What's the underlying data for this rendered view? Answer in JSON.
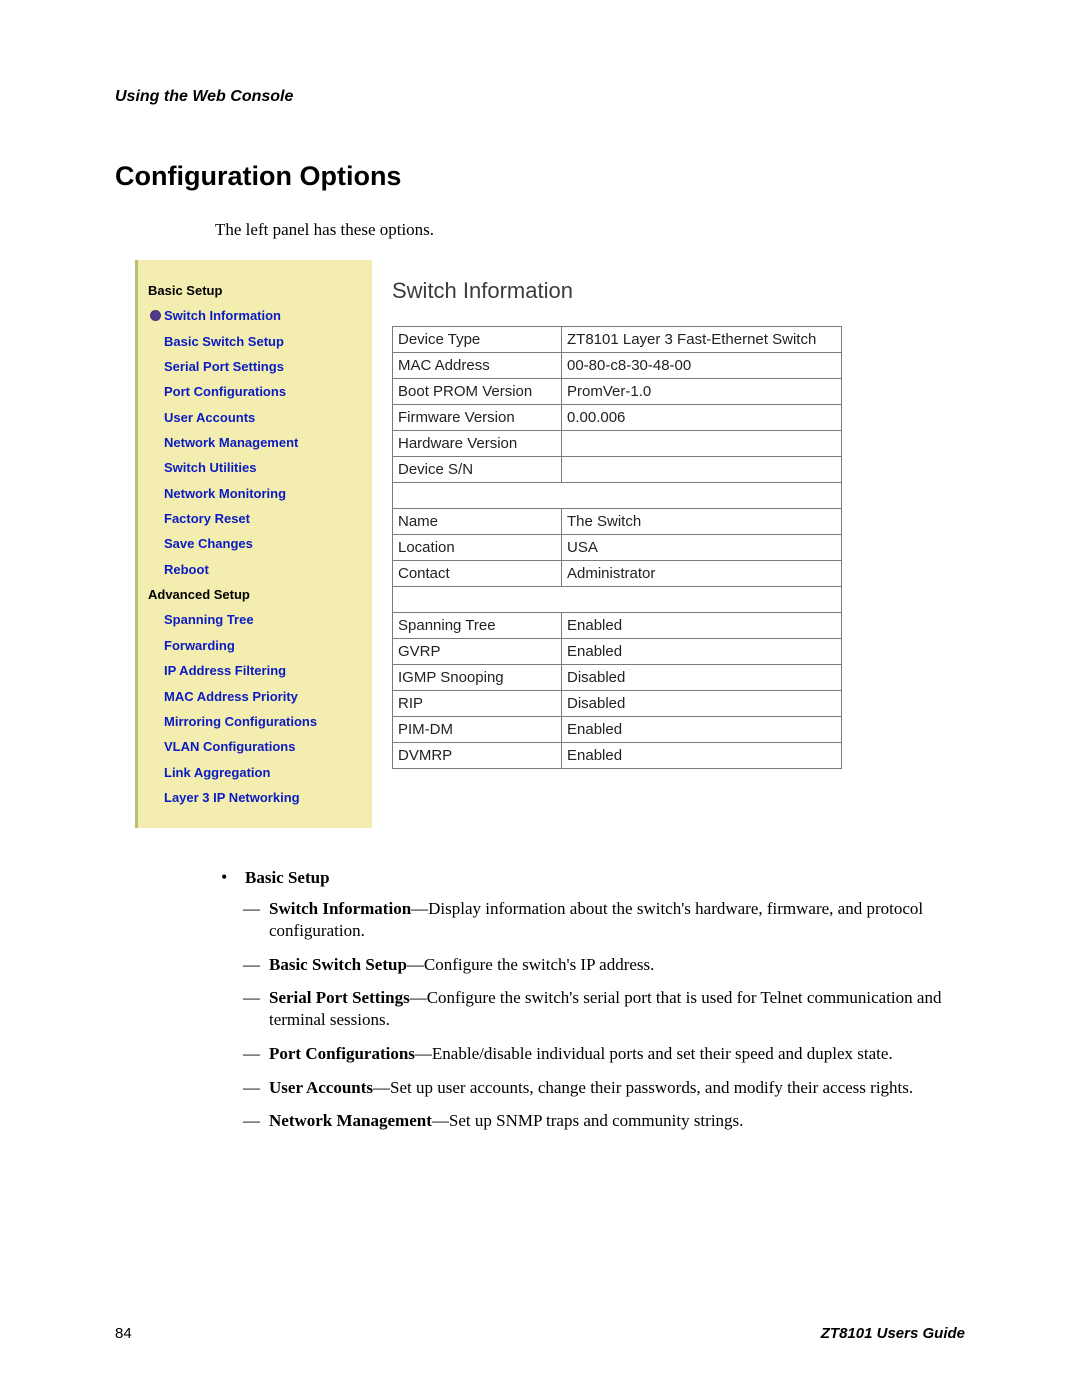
{
  "header": {
    "running": "Using the Web Console"
  },
  "section": {
    "title": "Configuration Options",
    "intro": "The left panel has these options."
  },
  "sidebar": {
    "groups": [
      {
        "label": "Basic Setup",
        "items": [
          "Switch Information",
          "Basic Switch Setup",
          "Serial Port Settings",
          "Port Configurations",
          "User Accounts",
          "Network Management",
          "Switch Utilities",
          "Network Monitoring",
          "Factory Reset",
          "Save Changes",
          "Reboot"
        ],
        "active_index": 0
      },
      {
        "label": "Advanced Setup",
        "items": [
          "Spanning Tree",
          "Forwarding",
          "IP Address Filtering",
          "MAC Address Priority",
          "Mirroring Configurations",
          "VLAN Configurations",
          "Link Aggregation",
          "Layer 3 IP Networking"
        ]
      }
    ]
  },
  "mainpane": {
    "title": "Switch Information",
    "rows": [
      {
        "k": "Device Type",
        "v": "ZT8101 Layer 3 Fast-Ethernet Switch"
      },
      {
        "k": "MAC Address",
        "v": "00-80-c8-30-48-00"
      },
      {
        "k": "Boot PROM Version",
        "v": "PromVer-1.0"
      },
      {
        "k": "Firmware Version",
        "v": "0.00.006"
      },
      {
        "k": "Hardware Version",
        "v": ""
      },
      {
        "k": "Device S/N",
        "v": ""
      },
      {
        "spacer": true
      },
      {
        "k": "Name",
        "v": "The Switch"
      },
      {
        "k": "Location",
        "v": "USA"
      },
      {
        "k": "Contact",
        "v": "Administrator"
      },
      {
        "spacer": true
      },
      {
        "k": "Spanning Tree",
        "v": "Enabled"
      },
      {
        "k": "GVRP",
        "v": "Enabled"
      },
      {
        "k": "IGMP Snooping",
        "v": "Disabled"
      },
      {
        "k": "RIP",
        "v": "Disabled"
      },
      {
        "k": "PIM-DM",
        "v": "Enabled"
      },
      {
        "k": "DVMRP",
        "v": "Enabled"
      }
    ]
  },
  "body": {
    "group_label": "Basic Setup",
    "items": [
      {
        "term": "Switch Information",
        "desc": "—Display information about the switch's hardware, firmware, and protocol configuration."
      },
      {
        "term": "Basic Switch Setup",
        "desc": "—Configure the switch's IP address."
      },
      {
        "term": "Serial Port Settings",
        "desc": "—Configure the switch's serial port that is used for Telnet communication and terminal sessions."
      },
      {
        "term": "Port Configurations",
        "desc": "—Enable/disable individual ports and set their speed and duplex state."
      },
      {
        "term": "User Accounts",
        "desc": "—Set up user accounts, change their passwords, and modify their access rights."
      },
      {
        "term": "Network Management",
        "desc": "—Set up SNMP traps and community strings."
      }
    ]
  },
  "footer": {
    "page": "84",
    "guide": "ZT8101 Users Guide"
  }
}
